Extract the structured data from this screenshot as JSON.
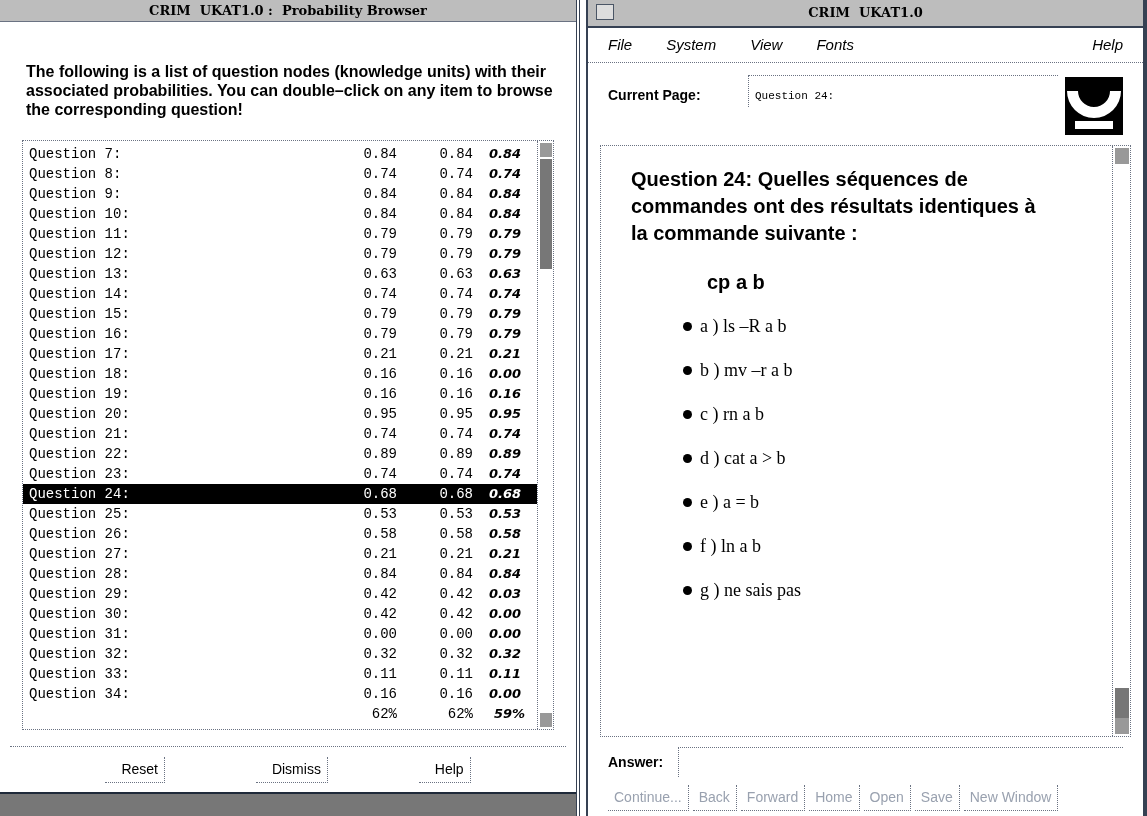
{
  "left_window": {
    "title": "CRIM  UKAT1.0 :  Probability Browser",
    "intro": "The following is a list of question nodes (knowledge units) with their associated probabilities.  You can double–click on any item to browse the corresponding question!",
    "rows": [
      {
        "label": "Question 7:",
        "column_2": "0.84",
        "column_3": "0.84",
        "column_4": "0.84",
        "selected": false
      },
      {
        "label": "Question 8:",
        "column_2": "0.74",
        "column_3": "0.74",
        "column_4": "0.74",
        "selected": false
      },
      {
        "label": "Question 9:",
        "column_2": "0.84",
        "column_3": "0.84",
        "column_4": "0.84",
        "selected": false
      },
      {
        "label": "Question 10:",
        "column_2": "0.84",
        "column_3": "0.84",
        "column_4": "0.84",
        "selected": false
      },
      {
        "label": "Question 11:",
        "column_2": "0.79",
        "column_3": "0.79",
        "column_4": "0.79",
        "selected": false
      },
      {
        "label": "Question 12:",
        "column_2": "0.79",
        "column_3": "0.79",
        "column_4": "0.79",
        "selected": false
      },
      {
        "label": "Question 13:",
        "column_2": "0.63",
        "column_3": "0.63",
        "column_4": "0.63",
        "selected": false
      },
      {
        "label": "Question 14:",
        "column_2": "0.74",
        "column_3": "0.74",
        "column_4": "0.74",
        "selected": false
      },
      {
        "label": "Question 15:",
        "column_2": "0.79",
        "column_3": "0.79",
        "column_4": "0.79",
        "selected": false
      },
      {
        "label": "Question 16:",
        "column_2": "0.79",
        "column_3": "0.79",
        "column_4": "0.79",
        "selected": false
      },
      {
        "label": "Question 17:",
        "column_2": "0.21",
        "column_3": "0.21",
        "column_4": "0.21",
        "selected": false
      },
      {
        "label": "Question 18:",
        "column_2": "0.16",
        "column_3": "0.16",
        "column_4": "0.00",
        "selected": false
      },
      {
        "label": "Question 19:",
        "column_2": "0.16",
        "column_3": "0.16",
        "column_4": "0.16",
        "selected": false
      },
      {
        "label": "Question 20:",
        "column_2": "0.95",
        "column_3": "0.95",
        "column_4": "0.95",
        "selected": false
      },
      {
        "label": "Question 21:",
        "column_2": "0.74",
        "column_3": "0.74",
        "column_4": "0.74",
        "selected": false
      },
      {
        "label": "Question 22:",
        "column_2": "0.89",
        "column_3": "0.89",
        "column_4": "0.89",
        "selected": false
      },
      {
        "label": "Question 23:",
        "column_2": "0.74",
        "column_3": "0.74",
        "column_4": "0.74",
        "selected": false
      },
      {
        "label": "Question 24:",
        "column_2": "0.68",
        "column_3": "0.68",
        "column_4": "0.68",
        "selected": true
      },
      {
        "label": "Question 25:",
        "column_2": "0.53",
        "column_3": "0.53",
        "column_4": "0.53",
        "selected": false
      },
      {
        "label": "Question 26:",
        "column_2": "0.58",
        "column_3": "0.58",
        "column_4": "0.58",
        "selected": false
      },
      {
        "label": "Question 27:",
        "column_2": "0.21",
        "column_3": "0.21",
        "column_4": "0.21",
        "selected": false
      },
      {
        "label": "Question 28:",
        "column_2": "0.84",
        "column_3": "0.84",
        "column_4": "0.84",
        "selected": false
      },
      {
        "label": "Question 29:",
        "column_2": "0.42",
        "column_3": "0.42",
        "column_4": "0.03",
        "selected": false
      },
      {
        "label": "Question 30:",
        "column_2": "0.42",
        "column_3": "0.42",
        "column_4": "0.00",
        "selected": false
      },
      {
        "label": "Question 31:",
        "column_2": "0.00",
        "column_3": "0.00",
        "column_4": "0.00",
        "selected": false
      },
      {
        "label": "Question 32:",
        "column_2": "0.32",
        "column_3": "0.32",
        "column_4": "0.32",
        "selected": false
      },
      {
        "label": "Question 33:",
        "column_2": "0.11",
        "column_3": "0.11",
        "column_4": "0.11",
        "selected": false
      },
      {
        "label": "Question 34:",
        "column_2": "0.16",
        "column_3": "0.16",
        "column_4": "0.00",
        "selected": false
      }
    ],
    "totals": {
      "column_2": "62%",
      "column_3": "62%",
      "column_4": "59%"
    },
    "buttons": [
      {
        "label": "Reset",
        "disabled": false
      },
      {
        "label": "Dismiss",
        "disabled": false
      },
      {
        "label": "Help",
        "disabled": false
      }
    ]
  },
  "right_window": {
    "title": "CRIM  UKAT1.0",
    "menu": [
      {
        "label": "File",
        "kind": "menu"
      },
      {
        "label": "System",
        "kind": "menu"
      },
      {
        "label": "View",
        "kind": "menu"
      },
      {
        "label": "Fonts",
        "kind": "menu"
      },
      {
        "label": "Help",
        "kind": "help"
      }
    ],
    "current_page": {
      "label": "Current Page:",
      "value": "Question 24:"
    },
    "question": "Question 24: Quelles séquences de commandes ont des résultats identiques à la commande suivante :",
    "command": "cp a b",
    "options": [
      "a ) ls –R a b",
      "b ) mv –r a b",
      "c ) rn a b",
      "d ) cat a > b",
      "e ) a = b",
      "f ) ln a b",
      "g ) ne sais pas"
    ],
    "answer": {
      "label": "Answer:"
    },
    "buttons": [
      {
        "label": "Continue...",
        "disabled": true
      },
      {
        "label": "Back",
        "disabled": true
      },
      {
        "label": "Forward",
        "disabled": true
      },
      {
        "label": "Home",
        "disabled": true
      },
      {
        "label": "Open",
        "disabled": true
      },
      {
        "label": "Save",
        "disabled": true
      },
      {
        "label": "New Window",
        "disabled": true
      }
    ]
  }
}
